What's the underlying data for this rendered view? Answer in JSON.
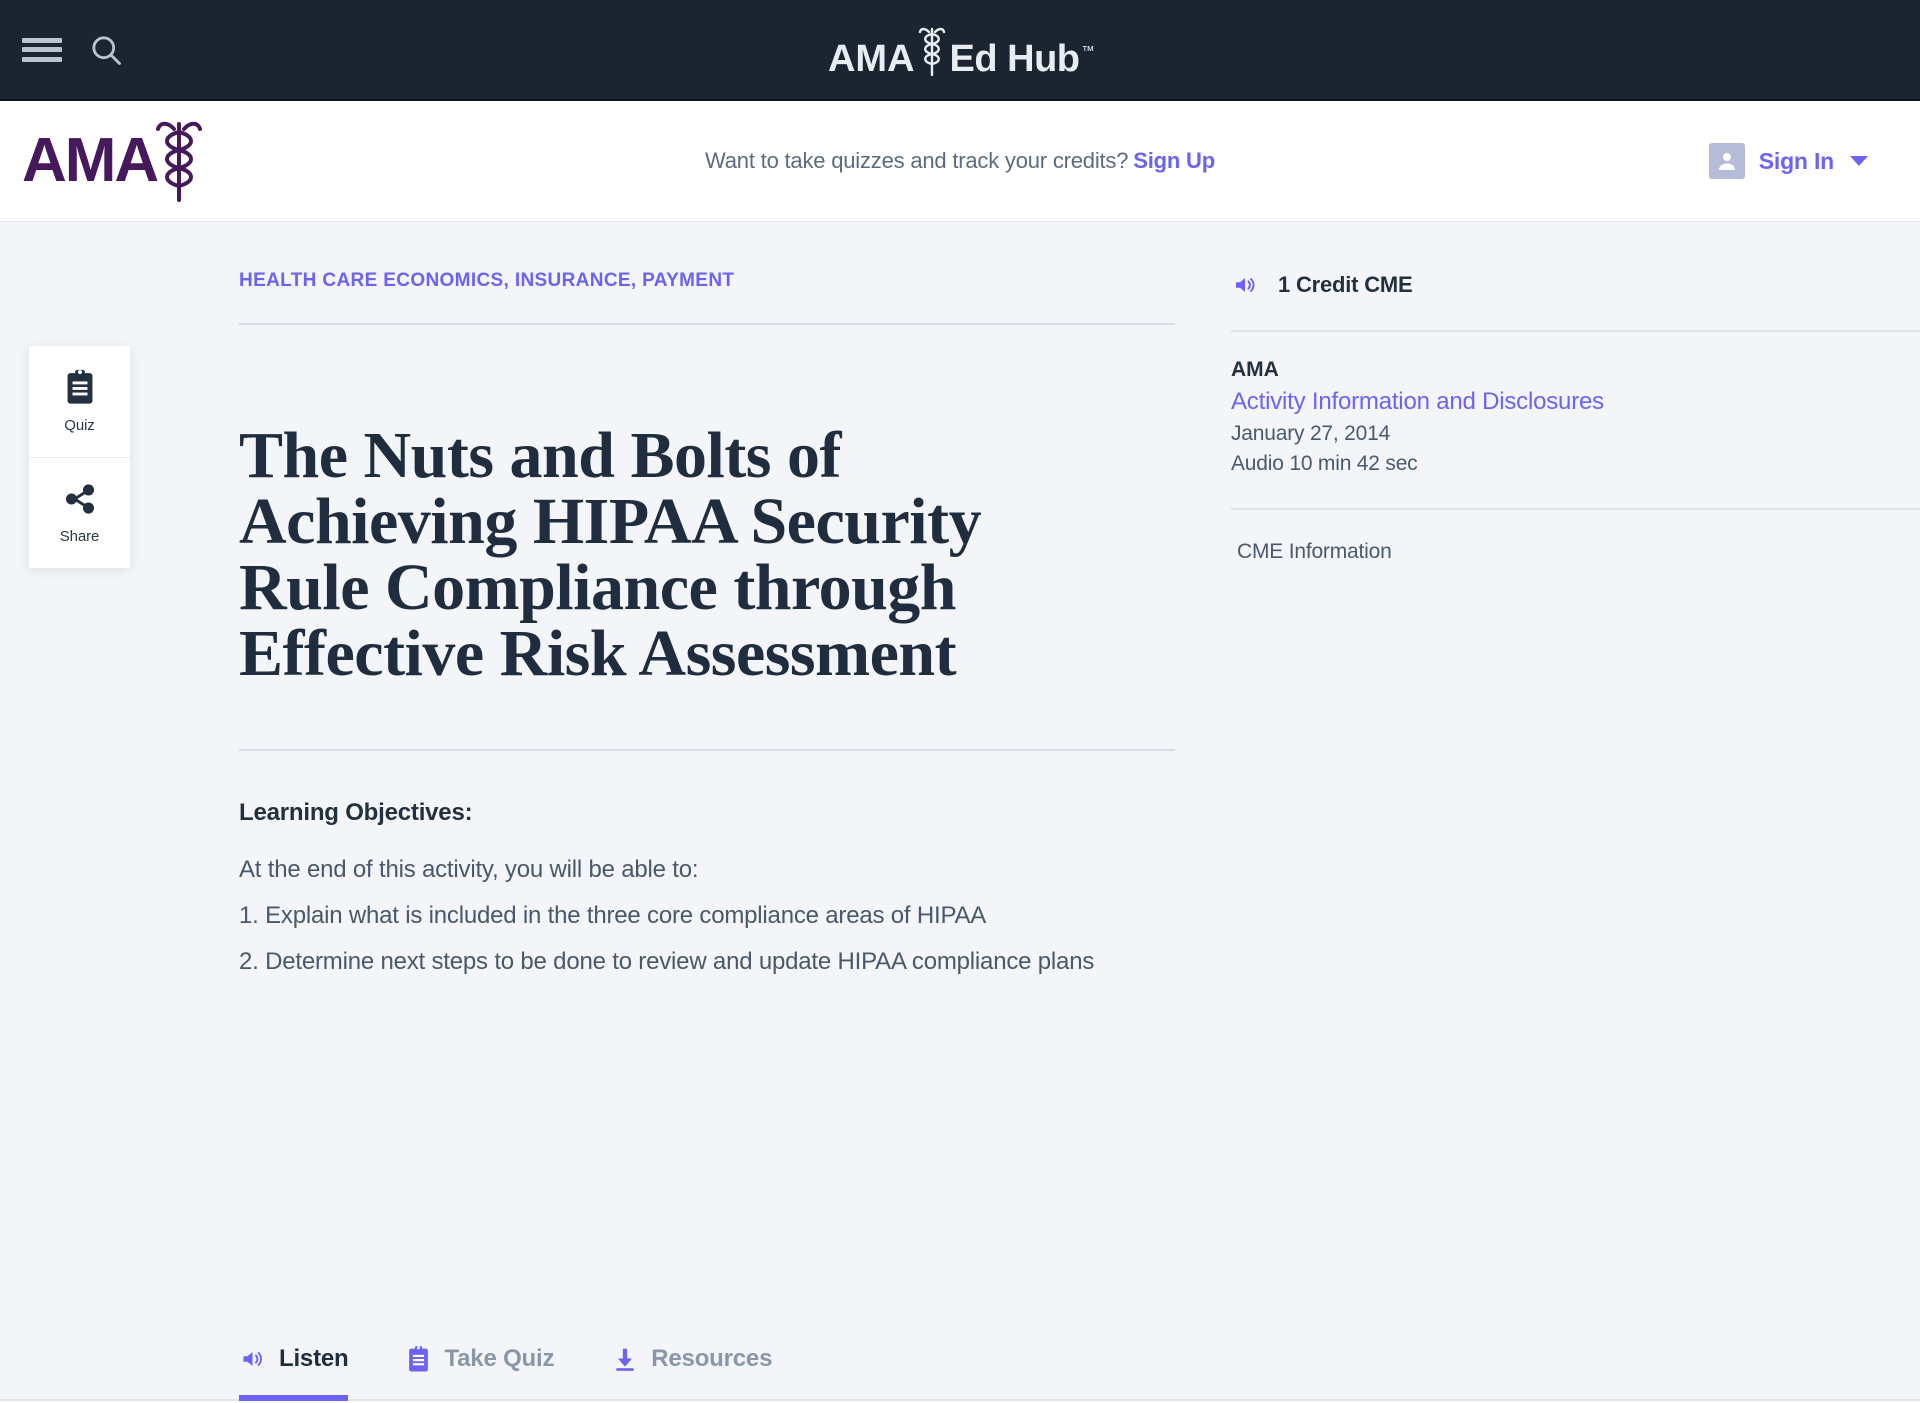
{
  "topbar": {
    "menu_icon": "hamburger-icon",
    "search_icon": "search-icon",
    "brand_ama": "AMA",
    "brand_edhub": "Ed Hub",
    "brand_tm": "™"
  },
  "subheader": {
    "logo_text": "AMA",
    "promo_text": "Want to take quizzes and track your credits?",
    "signup_label": "Sign Up",
    "signin_label": "Sign In",
    "avatar_icon": "person-icon",
    "caret_icon": "chevron-down-icon"
  },
  "side_card": {
    "items": [
      {
        "label": "Quiz",
        "icon": "clipboard-icon"
      },
      {
        "label": "Share",
        "icon": "share-nodes-icon"
      }
    ]
  },
  "article": {
    "eyebrow": "HEALTH CARE ECONOMICS, INSURANCE, PAYMENT",
    "title": "The Nuts and Bolts of Achieving HIPAA Security Rule Compliance through Effective Risk Assessment",
    "objectives_heading": "Learning Objectives:",
    "objectives_intro": "At the end of this activity, you will be able to:",
    "objective_1": "1. Explain what is included in the three core compliance areas of HIPAA",
    "objective_2": "2. Determine next steps to be done to review and update HIPAA compliance plans"
  },
  "sidebar": {
    "credit_icon": "audio-speaker-icon",
    "credit_text": "1 Credit  CME",
    "provider": "AMA",
    "disclosures_link": "Activity Information and Disclosures",
    "date": "January 27, 2014",
    "duration": "Audio 10 min 42 sec",
    "cme_information": "CME Information"
  },
  "tabs": [
    {
      "label": "Listen",
      "icon": "audio-speaker-icon",
      "active": true
    },
    {
      "label": "Take Quiz",
      "icon": "clipboard-icon",
      "active": false
    },
    {
      "label": "Resources",
      "icon": "download-icon",
      "active": false
    }
  ],
  "colors": {
    "topbar_bg": "#1b2431",
    "page_bg": "#f3f5f8",
    "accent_purple": "#6c63f5",
    "ama_purple": "#46185c",
    "text_dark": "#1f2d3f",
    "text_muted": "#8a97ab"
  }
}
